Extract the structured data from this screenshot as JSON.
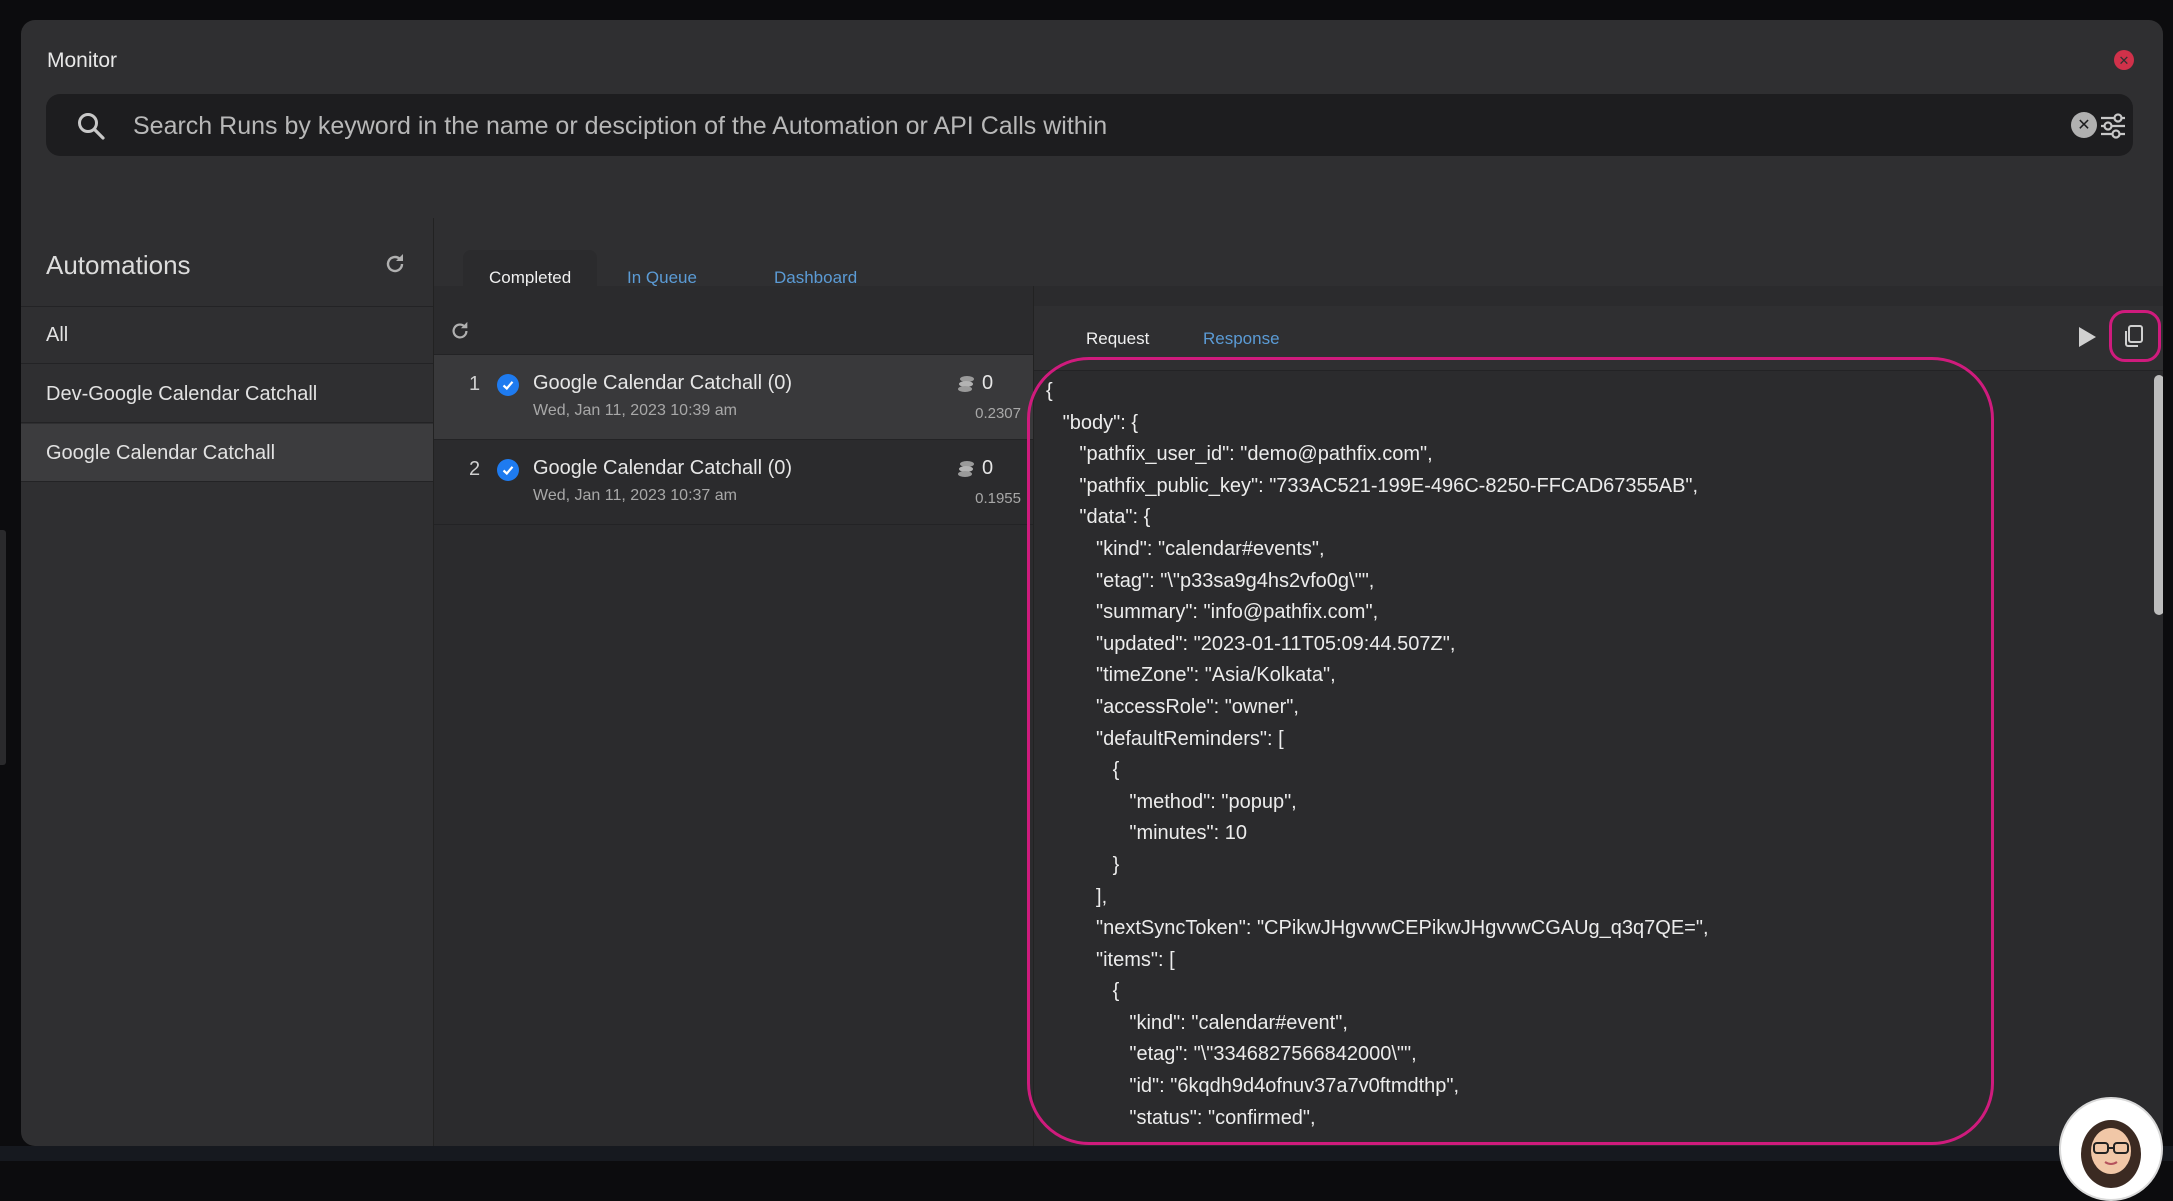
{
  "window": {
    "title": "Monitor"
  },
  "search": {
    "placeholder": "Search Runs by keyword in the name or desciption of the Automation or API Calls within"
  },
  "sidebar": {
    "title": "Automations",
    "items": [
      {
        "label": "All"
      },
      {
        "label": "Dev-Google Calendar Catchall"
      },
      {
        "label": "Google Calendar Catchall"
      }
    ]
  },
  "tabs": [
    {
      "label": "Completed"
    },
    {
      "label": "In Queue"
    },
    {
      "label": "Dashboard"
    }
  ],
  "runs": [
    {
      "index": "1",
      "name": "Google Calendar Catchall (0)",
      "time": "Wed, Jan 11, 2023 10:39 am",
      "count": "0",
      "cost": "0.2307"
    },
    {
      "index": "2",
      "name": "Google Calendar Catchall (0)",
      "time": "Wed, Jan 11, 2023 10:37 am",
      "count": "0",
      "cost": "0.1955"
    }
  ],
  "detail": {
    "tabs": {
      "request": "Request",
      "response": "Response"
    },
    "json_lines": [
      "{",
      "   \"body\": {",
      "      \"pathfix_user_id\": \"demo@pathfix.com\",",
      "      \"pathfix_public_key\": \"733AC521-199E-496C-8250-FFCAD67355AB\",",
      "      \"data\": {",
      "         \"kind\": \"calendar#events\",",
      "         \"etag\": \"\\\"p33sa9g4hs2vfo0g\\\"\",",
      "         \"summary\": \"info@pathfix.com\",",
      "         \"updated\": \"2023-01-11T05:09:44.507Z\",",
      "         \"timeZone\": \"Asia/Kolkata\",",
      "         \"accessRole\": \"owner\",",
      "         \"defaultReminders\": [",
      "            {",
      "               \"method\": \"popup\",",
      "               \"minutes\": 10",
      "            }",
      "         ],",
      "         \"nextSyncToken\": \"CPikwJHgvvwCEPikwJHgvvwCGAUg_q3q7QE=\",",
      "         \"items\": [",
      "            {",
      "               \"kind\": \"calendar#event\",",
      "               \"etag\": \"\\\"3346827566842000\\\"\",",
      "               \"id\": \"6kqdh9d4ofnuv37a7v0ftmdthp\",",
      "               \"status\": \"confirmed\","
    ]
  },
  "colors": {
    "accent_link": "#5b9bd5",
    "highlight": "#cf1b7d",
    "close": "#d0314a",
    "check": "#1e7bf0"
  },
  "icons": {
    "search": "search-icon",
    "clear": "clear-search-icon",
    "filter": "sliders-icon",
    "refresh": "refresh-icon",
    "play": "play-icon",
    "copy": "copy-icon",
    "close": "close-icon",
    "check": "check-circle-icon",
    "coins": "coins-icon"
  }
}
